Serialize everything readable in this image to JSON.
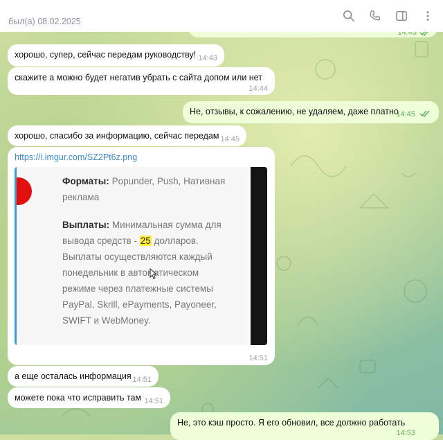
{
  "header": {
    "last_seen": "был(а) 08.02.2025",
    "icons": [
      "search-icon",
      "phone-icon",
      "sidebar-icon",
      "more-icon"
    ]
  },
  "messages": [
    {
      "dir": "in",
      "text": "хорошо, супер, сейчас передам руководству!",
      "time": "14:43"
    },
    {
      "dir": "in",
      "text": "скажите а можно будет негатив убрать с сайта допом или нет",
      "time": "14:44"
    },
    {
      "dir": "out",
      "text": "Не, отзывы, к сожалению, не удаляем, даже платно",
      "time": "14:45",
      "read": true
    },
    {
      "dir": "in",
      "text": "хорошо, спасибо за информацию, сейчас передам",
      "time": "14:45"
    },
    {
      "dir": "in",
      "link": "https://i.imgur.com/SZ2Pt6z.png",
      "time": "14:51"
    },
    {
      "dir": "in",
      "text": "а еще осталась информация",
      "time": "14:51"
    },
    {
      "dir": "in",
      "text": "можете пока что исправить там",
      "time": "14:51"
    },
    {
      "dir": "out",
      "text": "Не, это кэш просто. Я его обновил, все должно работать",
      "time": "14:53"
    }
  ],
  "top_partial": {
    "time": "14:43"
  },
  "preview": {
    "formats_label": "Форматы:",
    "formats_line1": "Popunder, Push, Нативная",
    "formats_line2": "реклама",
    "payouts_label": "Выплаты:",
    "payouts_line1": "Минимальная сумма для",
    "payouts_line2_pre": "вывода средств -",
    "payouts_amount": "25",
    "payouts_line2_post": "долларов.",
    "payouts_line3": "Выплаты осуществляются каждый",
    "payouts_line4": "понедельник в автоматическом",
    "payouts_line5": "режиме через платежные системы",
    "payouts_line6": "PayPal, Skrill, ePayments, Payoneer,",
    "payouts_line7": "SWIFT и WebMoney."
  },
  "colors": {
    "accent": "#3d9bd6",
    "outgoing": "#eefed9",
    "check": "#5fb15a",
    "brand_red": "#e20f0f"
  }
}
